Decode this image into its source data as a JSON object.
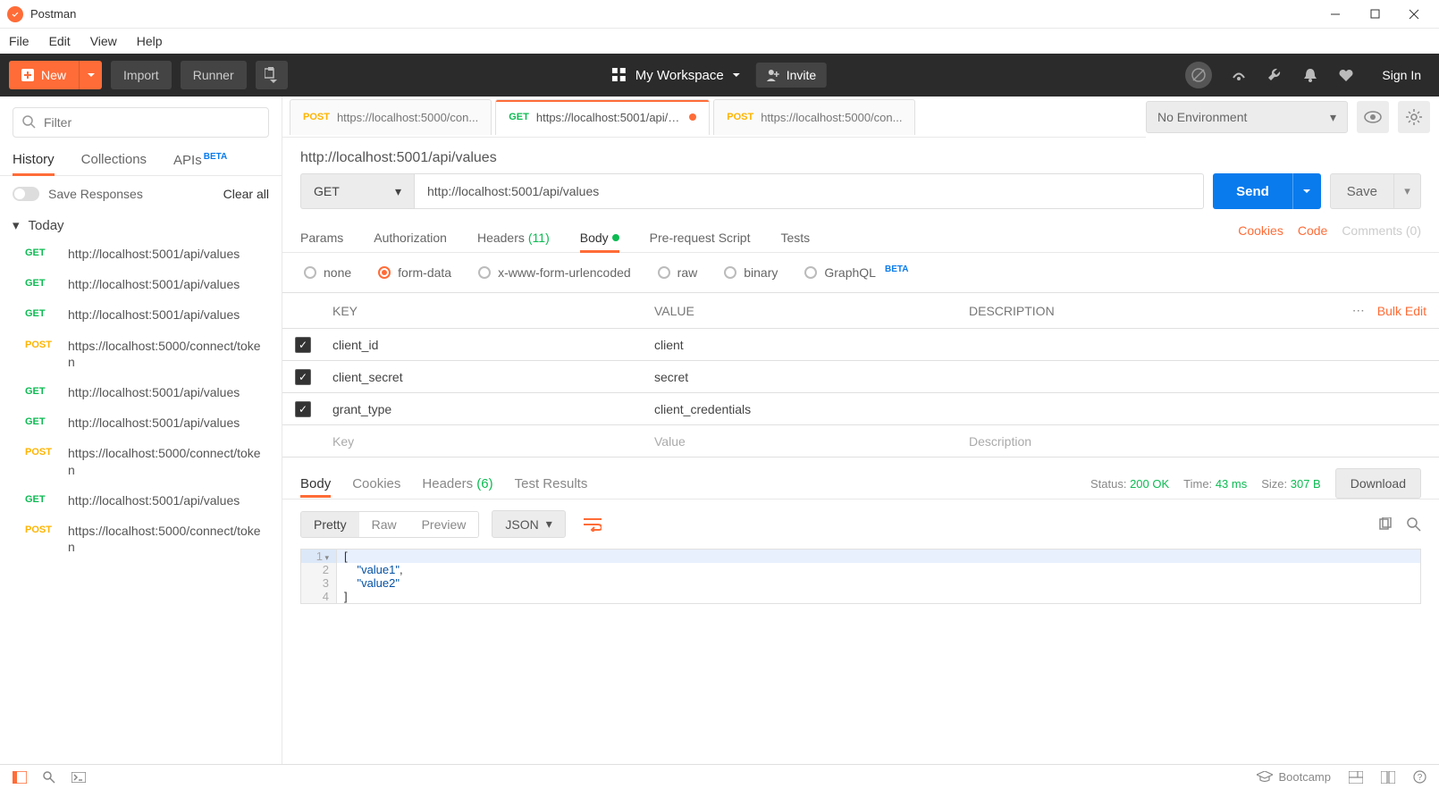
{
  "app": {
    "title": "Postman"
  },
  "menu": {
    "file": "File",
    "edit": "Edit",
    "view": "View",
    "help": "Help"
  },
  "toolbar": {
    "new": "New",
    "import": "Import",
    "runner": "Runner",
    "workspace": "My Workspace",
    "invite": "Invite",
    "signin": "Sign In"
  },
  "sidebar": {
    "filter_placeholder": "Filter",
    "tabs": {
      "history": "History",
      "collections": "Collections",
      "apis": "APIs",
      "apis_badge": "BETA"
    },
    "save_responses": "Save Responses",
    "clear_all": "Clear all",
    "section": "Today",
    "items": [
      {
        "method": "GET",
        "url": "http://localhost:5001/api/values"
      },
      {
        "method": "GET",
        "url": "http://localhost:5001/api/values"
      },
      {
        "method": "GET",
        "url": "http://localhost:5001/api/values"
      },
      {
        "method": "POST",
        "url": "https://localhost:5000/connect/token"
      },
      {
        "method": "GET",
        "url": "http://localhost:5001/api/values"
      },
      {
        "method": "GET",
        "url": "http://localhost:5001/api/values"
      },
      {
        "method": "POST",
        "url": "https://localhost:5000/connect/token"
      },
      {
        "method": "GET",
        "url": "http://localhost:5001/api/values"
      },
      {
        "method": "POST",
        "url": "https://localhost:5000/connect/token"
      }
    ]
  },
  "tabs": [
    {
      "method": "POST",
      "url": "https://localhost:5000/con...",
      "active": false,
      "dirty": false
    },
    {
      "method": "GET",
      "url": "https://localhost:5001/api/v...",
      "active": true,
      "dirty": true
    },
    {
      "method": "POST",
      "url": "https://localhost:5000/con...",
      "active": false,
      "dirty": false
    }
  ],
  "env": {
    "selected": "No Environment"
  },
  "request": {
    "title": "http://localhost:5001/api/values",
    "method": "GET",
    "url": "http://localhost:5001/api/values",
    "send": "Send",
    "save": "Save",
    "subtabs": {
      "params": "Params",
      "auth": "Authorization",
      "headers": "Headers",
      "headers_count": "(11)",
      "body": "Body",
      "prereq": "Pre-request Script",
      "tests": "Tests"
    },
    "actions": {
      "cookies": "Cookies",
      "code": "Code",
      "comments": "Comments (0)"
    },
    "body_types": {
      "none": "none",
      "formdata": "form-data",
      "xwww": "x-www-form-urlencoded",
      "raw": "raw",
      "binary": "binary",
      "graphql": "GraphQL",
      "graphql_badge": "BETA"
    },
    "kv": {
      "headers": {
        "key": "KEY",
        "value": "VALUE",
        "desc": "DESCRIPTION",
        "bulk": "Bulk Edit"
      },
      "rows": [
        {
          "key": "client_id",
          "value": "client"
        },
        {
          "key": "client_secret",
          "value": "secret"
        },
        {
          "key": "grant_type",
          "value": "client_credentials"
        }
      ],
      "placeholder": {
        "key": "Key",
        "value": "Value",
        "desc": "Description"
      }
    }
  },
  "response": {
    "tabs": {
      "body": "Body",
      "cookies": "Cookies",
      "headers": "Headers",
      "headers_count": "(6)",
      "test": "Test Results"
    },
    "meta": {
      "status_label": "Status:",
      "status": "200 OK",
      "time_label": "Time:",
      "time": "43 ms",
      "size_label": "Size:",
      "size": "307 B"
    },
    "download": "Download",
    "view": {
      "pretty": "Pretty",
      "raw": "Raw",
      "preview": "Preview",
      "format": "JSON"
    },
    "code": [
      "[",
      "    \"value1\",",
      "    \"value2\"",
      "]"
    ]
  },
  "statusbar": {
    "bootcamp": "Bootcamp"
  }
}
